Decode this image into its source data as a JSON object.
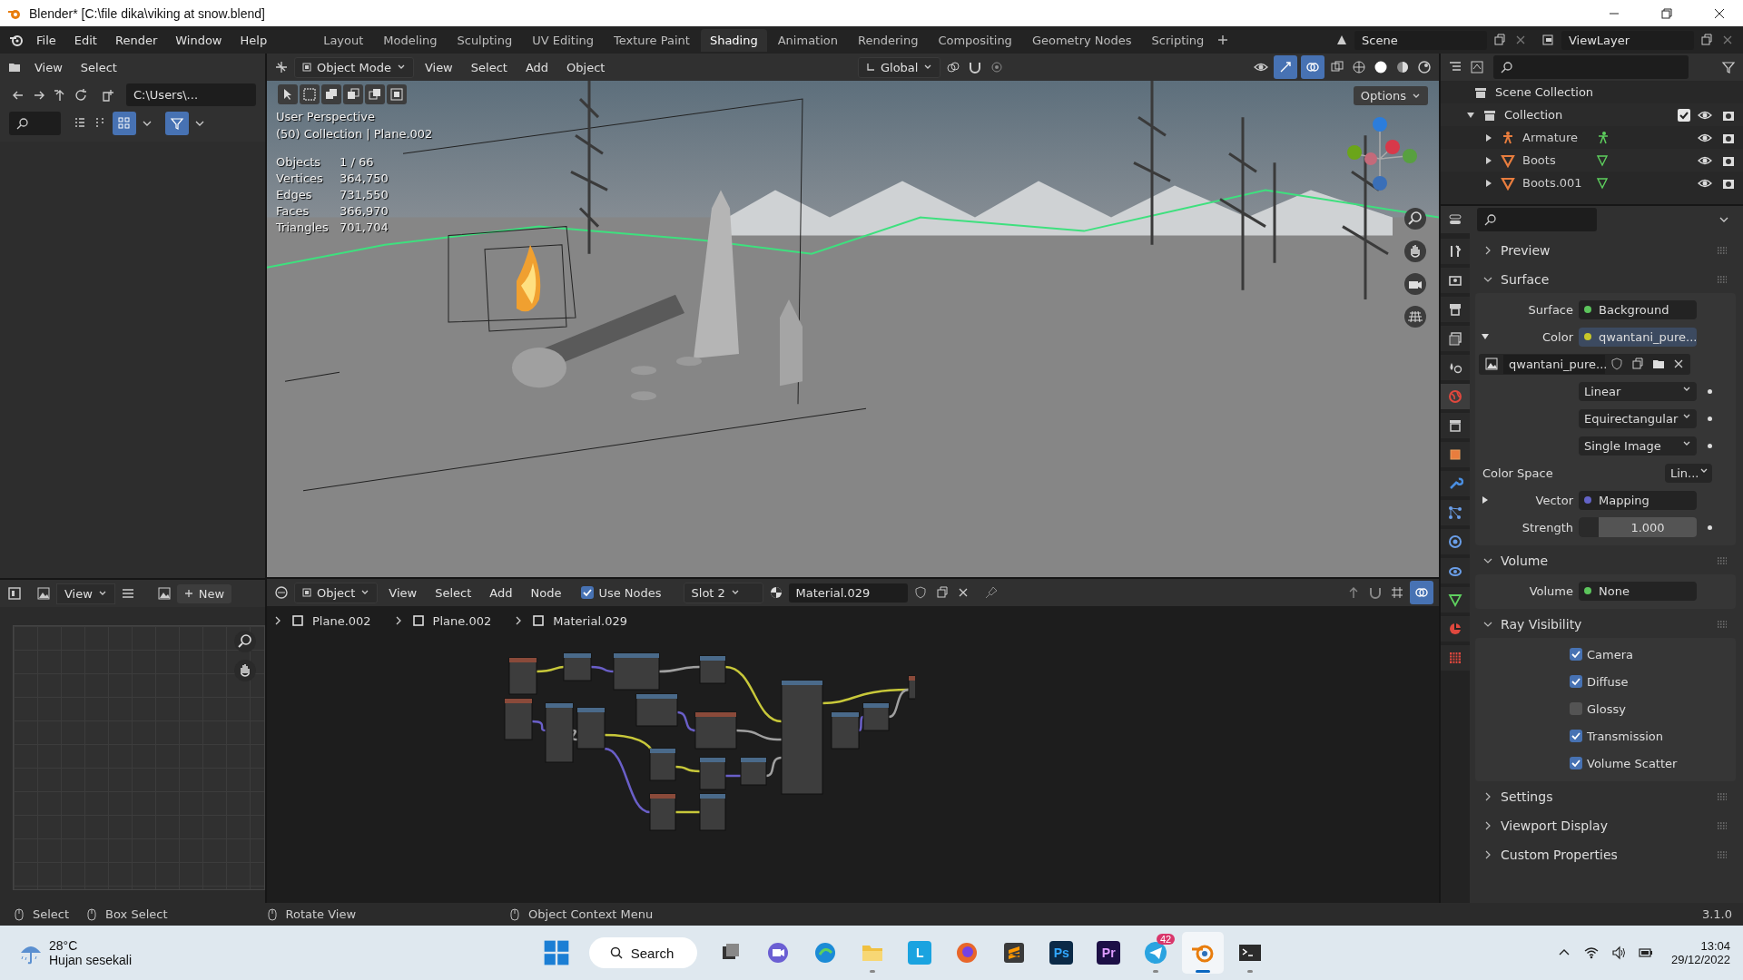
{
  "window": {
    "title": "Blender* [C:\\file dika\\viking at snow.blend]"
  },
  "menu": [
    "File",
    "Edit",
    "Render",
    "Window",
    "Help"
  ],
  "workspaces": [
    {
      "label": "Layout",
      "selected": false
    },
    {
      "label": "Modeling",
      "selected": false
    },
    {
      "label": "Sculpting",
      "selected": false
    },
    {
      "label": "UV Editing",
      "selected": false
    },
    {
      "label": "Texture Paint",
      "selected": false
    },
    {
      "label": "Shading",
      "selected": true
    },
    {
      "label": "Animation",
      "selected": false
    },
    {
      "label": "Rendering",
      "selected": false
    },
    {
      "label": "Compositing",
      "selected": false
    },
    {
      "label": "Geometry Nodes",
      "selected": false
    },
    {
      "label": "Scripting",
      "selected": false
    }
  ],
  "scene": "Scene",
  "view_layer": "ViewLayer",
  "file_browser": {
    "menus": [
      "View",
      "Select"
    ],
    "path": "C:\\Users\\..."
  },
  "viewport": {
    "mode": "Object Mode",
    "menus": [
      "View",
      "Select",
      "Add",
      "Object"
    ],
    "orientation": "Global",
    "options": "Options",
    "view_name": "User Perspective",
    "context": "(50) Collection | Plane.002",
    "stats": [
      {
        "label": "Objects",
        "value": "1 / 66"
      },
      {
        "label": "Vertices",
        "value": "364,750"
      },
      {
        "label": "Edges",
        "value": "731,550"
      },
      {
        "label": "Faces",
        "value": "366,970"
      },
      {
        "label": "Triangles",
        "value": "701,704"
      }
    ]
  },
  "image_editor": {
    "view": "View",
    "new": "New"
  },
  "node_editor": {
    "type": "Object",
    "menus": [
      "View",
      "Select",
      "Add",
      "Node"
    ],
    "use_nodes": {
      "label": "Use Nodes",
      "checked": true
    },
    "slot": "Slot 2",
    "material": "Material.029",
    "breadcrumb": [
      "Plane.002",
      "Plane.002",
      "Material.029"
    ]
  },
  "outliner": {
    "root": "Scene Collection",
    "collection": {
      "label": "Collection",
      "expanded": true,
      "checked": true,
      "children": [
        {
          "label": "Armature",
          "kind": "armature"
        },
        {
          "label": "Boots",
          "kind": "mesh"
        },
        {
          "label": "Boots.001",
          "kind": "mesh"
        }
      ]
    }
  },
  "properties": {
    "sections": [
      {
        "title": "Preview",
        "expanded": false
      },
      {
        "title": "Surface",
        "expanded": true,
        "rows": [
          {
            "kind": "socket",
            "label": "Surface",
            "value": "Background",
            "color": "#5cc45c"
          },
          {
            "kind": "socket",
            "label": "Color",
            "value": "qwantani_pure...",
            "color": "#c7c729",
            "expanded": true
          },
          {
            "kind": "image",
            "value": "qwantani_pure..."
          },
          {
            "kind": "dropdown",
            "value": "Linear"
          },
          {
            "kind": "dropdown",
            "value": "Equirectangular"
          },
          {
            "kind": "dropdown",
            "value": "Single Image"
          },
          {
            "kind": "colorspace",
            "label": "Color Space",
            "value": "Lin..."
          },
          {
            "kind": "socket",
            "label": "Vector",
            "value": "Mapping",
            "color": "#6363c7",
            "expanded": false
          },
          {
            "kind": "number",
            "label": "Strength",
            "value": "1.000"
          }
        ]
      },
      {
        "title": "Volume",
        "expanded": true,
        "rows": [
          {
            "kind": "socket",
            "label": "Volume",
            "value": "None",
            "color": "#5cc45c"
          }
        ]
      },
      {
        "title": "Ray Visibility",
        "expanded": true,
        "rows": [
          {
            "kind": "checkbox",
            "label": "Camera",
            "checked": true
          },
          {
            "kind": "checkbox",
            "label": "Diffuse",
            "checked": true
          },
          {
            "kind": "checkbox",
            "label": "Glossy",
            "checked": false
          },
          {
            "kind": "checkbox",
            "label": "Transmission",
            "checked": true
          },
          {
            "kind": "checkbox",
            "label": "Volume Scatter",
            "checked": true
          }
        ]
      },
      {
        "title": "Settings",
        "expanded": false
      },
      {
        "title": "Viewport Display",
        "expanded": false
      },
      {
        "title": "Custom Properties",
        "expanded": false
      }
    ]
  },
  "status_bar": {
    "hints": [
      "Select",
      "Box Select",
      "Rotate View",
      "Object Context Menu"
    ],
    "version": "3.1.0"
  },
  "taskbar": {
    "temperature": "28°C",
    "weather": "Hujan sesekali",
    "search": "Search",
    "apps": [
      {
        "kind": "taskview",
        "running": false,
        "selected": false
      },
      {
        "kind": "chat",
        "running": false,
        "selected": false
      },
      {
        "kind": "browser",
        "running": false,
        "selected": false
      },
      {
        "kind": "files",
        "running": true,
        "selected": false
      },
      {
        "kind": "letter",
        "label": "L",
        "running": false,
        "selected": false
      },
      {
        "kind": "firefox",
        "running": false,
        "selected": false
      },
      {
        "kind": "sublime",
        "running": false,
        "selected": false
      },
      {
        "kind": "ps",
        "label": "Ps",
        "running": false,
        "selected": false
      },
      {
        "kind": "pr",
        "label": "Pr",
        "running": false,
        "selected": false
      },
      {
        "kind": "telegram",
        "badge": "42",
        "running": true,
        "selected": false
      },
      {
        "kind": "blender",
        "running": true,
        "selected": true
      },
      {
        "kind": "terminal",
        "running": true,
        "selected": false
      }
    ],
    "time": "13:04",
    "date": "29/12/2022"
  }
}
